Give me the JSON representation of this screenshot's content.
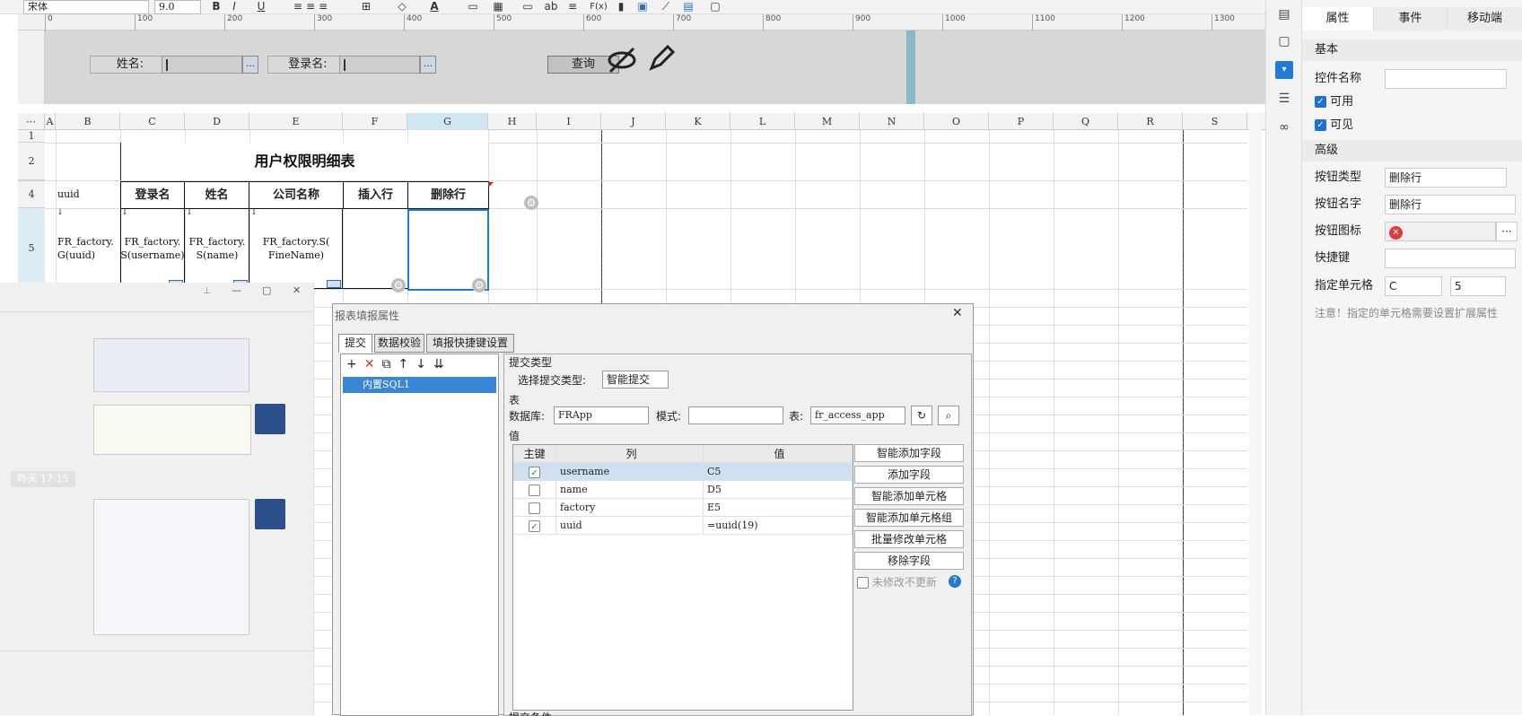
{
  "toolbar": {
    "font": "宋体",
    "size": "9.0",
    "bold": "B",
    "italic": "I",
    "underline": "U",
    "text_color": "A",
    "ab": "ab",
    "fx": "F(x)"
  },
  "ruler": [
    "0",
    "100",
    "200",
    "300",
    "400",
    "500",
    "600",
    "700",
    "800",
    "900",
    "1000",
    "1100",
    "1200",
    "1300"
  ],
  "params": {
    "name_label": "姓名:",
    "login_label": "登录名:",
    "query_button": "查询",
    "param_button_glyph": "…"
  },
  "columns": [
    "A",
    "B",
    "C",
    "D",
    "E",
    "F",
    "G",
    "H",
    "I",
    "J",
    "K",
    "L",
    "M",
    "N",
    "O",
    "P",
    "Q",
    "R",
    "S"
  ],
  "rows": [
    "1",
    "2",
    "",
    "4",
    "5"
  ],
  "sheet": {
    "title": "用户权限明细表",
    "uuid_label": "uuid",
    "headers": [
      "登录名",
      "姓名",
      "公司名称",
      "插入行",
      "删除行"
    ],
    "cells": {
      "b5": "FR_factory.\nG(uuid)",
      "c5": "FR_factory.\nS(username)",
      "d5": "FR_factory.\nS(name)",
      "e5": "FR_factory.S(\nFineName)"
    },
    "gear_glyph": "⚙",
    "expand_glyph": "↓"
  },
  "right_icons": [
    "cell-icon",
    "frame-icon",
    "widget-icon",
    "layer-icon",
    "link-icon"
  ],
  "properties": {
    "tabs": [
      "属性",
      "事件",
      "移动端"
    ],
    "section_basic": "基本",
    "control_name_label": "控件名称",
    "control_name_value": "",
    "enabled": "可用",
    "visible": "可见",
    "section_advanced": "高级",
    "button_type_label": "按钮类型",
    "button_type_value": "删除行",
    "button_name_label": "按钮名字",
    "button_name_value": "删除行",
    "button_icon_label": "按钮图标",
    "shortcut_label": "快捷键",
    "shortcut_value": "",
    "cell_label": "指定单元格",
    "cell_col": "C",
    "cell_row": "5",
    "note": "注意！指定的单元格需要设置扩展属性",
    "check_glyph": "✓",
    "more_glyph": "···",
    "dropdown_glyph": "⌄"
  },
  "chat": {
    "time_label": "昨天 17:15",
    "pin_glyph": "⊥",
    "min_glyph": "—",
    "max_glyph": "▢",
    "close_glyph": "✕"
  },
  "dialog": {
    "title": "报表填报属性",
    "close_glyph": "✕",
    "tabs": [
      "提交",
      "数据校验",
      "填报快捷键设置"
    ],
    "list_item": "内置SQL1",
    "submit_type_section": "提交类型",
    "submit_type_label": "选择提交类型:",
    "submit_type_value": "智能提交",
    "table_section": "表",
    "db_label": "数据库:",
    "db_value": "FRApp",
    "mode_label": "模式:",
    "mode_value": "",
    "table_label": "表:",
    "table_value": "fr_access_app",
    "value_section": "值",
    "col_headers": [
      "主键",
      "列",
      "值"
    ],
    "rows": [
      {
        "key": true,
        "col": "username",
        "val": "C5"
      },
      {
        "key": false,
        "col": "name",
        "val": "D5"
      },
      {
        "key": false,
        "col": "factory",
        "val": "E5"
      },
      {
        "key": true,
        "col": "uuid",
        "val": "=uuid(19)"
      }
    ],
    "buttons": [
      "智能添加字段",
      "添加字段",
      "智能添加单元格",
      "智能添加单元格组",
      "批量修改单元格",
      "移除字段"
    ],
    "no_update_label": "未修改不更新",
    "help_glyph": "?",
    "bottom_label": "提交条件",
    "toolbar_glyphs": [
      "+",
      "✕",
      "⧉",
      "↑",
      "↓",
      "⇊"
    ]
  }
}
